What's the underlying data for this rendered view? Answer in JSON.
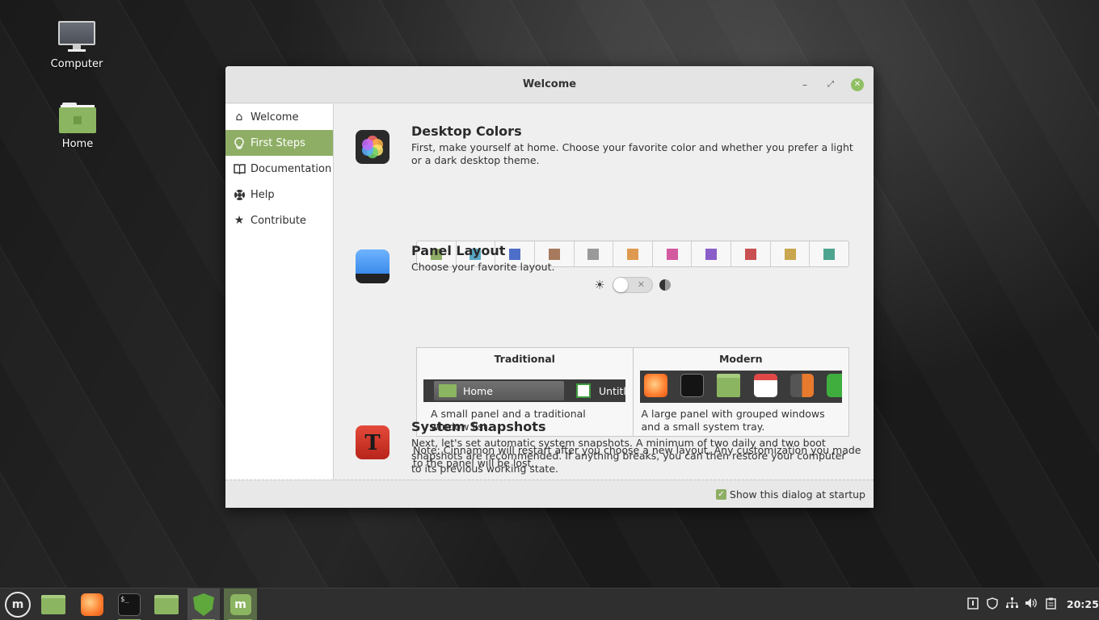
{
  "desktop": {
    "icons": [
      {
        "label": "Computer",
        "icon": "computer-icon"
      },
      {
        "label": "Home",
        "icon": "home-folder-icon"
      }
    ]
  },
  "window": {
    "title": "Welcome",
    "buttons": {
      "minimize": "–",
      "maximize": "⤢",
      "close": "✕"
    },
    "sidebar": {
      "items": [
        {
          "label": "Welcome",
          "icon": "home-icon",
          "glyph": "⌂"
        },
        {
          "label": "First Steps",
          "icon": "lightbulb-icon",
          "glyph": "💡",
          "active": true
        },
        {
          "label": "Documentation",
          "icon": "book-icon",
          "glyph": "📖"
        },
        {
          "label": "Help",
          "icon": "lifebuoy-icon",
          "glyph": "⛑"
        },
        {
          "label": "Contribute",
          "icon": "star-icon",
          "glyph": "★"
        }
      ]
    },
    "sections": {
      "colors": {
        "title": "Desktop Colors",
        "description": "First, make yourself at home. Choose your favorite color and whether you prefer a light or a dark desktop theme.",
        "swatches": [
          "#8fae65",
          "#5aa7c6",
          "#4e6fc9",
          "#a87a5d",
          "#9a9a9a",
          "#df9a4f",
          "#d35a9f",
          "#8a5fc9",
          "#c95050",
          "#c9a64f",
          "#4ea58f"
        ],
        "theme_switch": {
          "off_mark": "✕",
          "dark_mode": false
        }
      },
      "layout": {
        "title": "Panel Layout",
        "description": "Choose your favorite layout.",
        "traditional": {
          "name": "Traditional",
          "description": "A small panel and a traditional window list.",
          "preview_home": "Home",
          "preview_untitled": "Untitle"
        },
        "modern": {
          "name": "Modern",
          "description": "A large panel with grouped windows and a small system tray."
        },
        "note": "Note: Cinnamon will restart after you choose a new layout. Any customization you made to the panel will be lost."
      },
      "snapshots": {
        "title": "System Snapshots",
        "description": "Next, let's set automatic system snapshots. A minimum of two daily and two boot snapshots are recommended. If anything breaks, you can then restore your computer to its previous working state."
      }
    },
    "footer": {
      "startup_label": "Show this dialog at startup",
      "startup_checked": true
    }
  },
  "taskbar": {
    "menu_label": "m",
    "terminal_prompt": "$_",
    "mint_label": "m",
    "clock": "20:25",
    "tray_icons": [
      "update-icon",
      "shield-icon",
      "network-icon",
      "volume-icon",
      "clipboard-icon"
    ]
  }
}
